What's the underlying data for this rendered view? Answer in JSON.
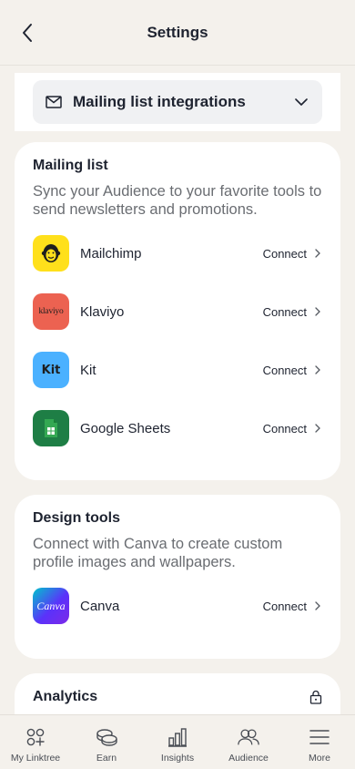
{
  "header": {
    "title": "Settings"
  },
  "dropdown": {
    "label": "Mailing list integrations"
  },
  "mailing": {
    "title": "Mailing list",
    "description": "Sync your Audience to your favorite tools to send newsletters and promotions.",
    "items": [
      {
        "name": "Mailchimp",
        "action": "Connect",
        "logo_bg": "#ffe01b"
      },
      {
        "name": "Klaviyo",
        "action": "Connect",
        "logo_bg": "#ec6251",
        "logo_text": "klaviyo"
      },
      {
        "name": "Kit",
        "action": "Connect",
        "logo_bg": "#4bb1ff",
        "logo_text": "Kit"
      },
      {
        "name": "Google Sheets",
        "action": "Connect",
        "logo_bg": "#1e7e45"
      }
    ]
  },
  "design": {
    "title": "Design tools",
    "description": "Connect with Canva to create custom profile images and wallpapers.",
    "items": [
      {
        "name": "Canva",
        "action": "Connect",
        "logo_text": "Canva"
      }
    ]
  },
  "analytics": {
    "title": "Analytics"
  },
  "nav": {
    "items": [
      {
        "label": "My Linktree",
        "icon": "linktree-icon"
      },
      {
        "label": "Earn",
        "icon": "coins-icon"
      },
      {
        "label": "Insights",
        "icon": "bar-chart-icon"
      },
      {
        "label": "Audience",
        "icon": "users-icon"
      },
      {
        "label": "More",
        "icon": "menu-icon"
      }
    ]
  }
}
